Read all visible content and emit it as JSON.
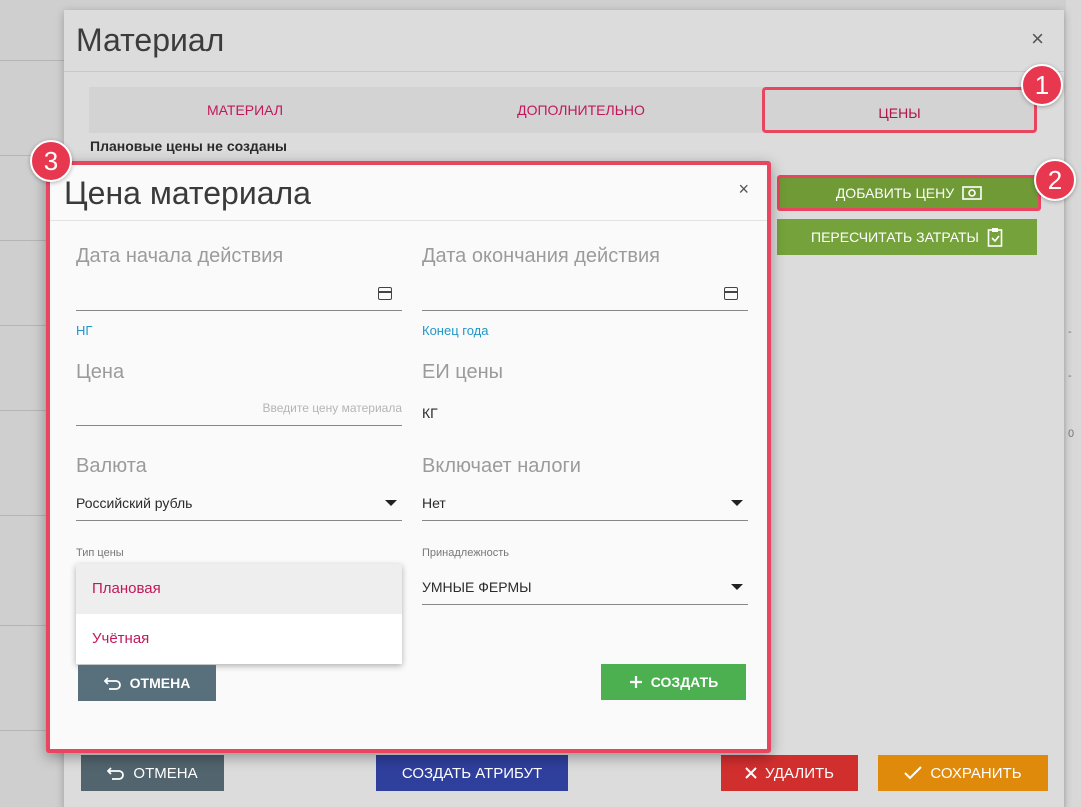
{
  "outer": {
    "title": "Материал",
    "close": "×",
    "tabs": [
      {
        "label": "МАТЕРИАЛ"
      },
      {
        "label": "ДОПОЛНИТЕЛЬНО"
      },
      {
        "label": "ЦЕНЫ"
      }
    ],
    "note": "Плановые цены не созданы",
    "add_price_label": "ДОБАВИТЬ ЦЕНУ",
    "recalc_label": "ПЕРЕСЧИТАТЬ ЗАТРАТЫ",
    "footer": {
      "cancel_label": "ОТМЕНА",
      "create_attr_label": "СОЗДАТЬ АТРИБУТ",
      "delete_label": "УДАЛИТЬ",
      "save_label": "СОХРАНИТЬ"
    }
  },
  "badges": [
    "1",
    "2",
    "3"
  ],
  "modal": {
    "title": "Цена материала",
    "close": "×",
    "start_date": {
      "label": "Дата начала действия",
      "value": "",
      "hint": "НГ"
    },
    "end_date": {
      "label": "Дата окончания действия",
      "value": "",
      "hint": "Конец года"
    },
    "price": {
      "label": "Цена",
      "placeholder": "Введите цену материала"
    },
    "unit": {
      "label": "ЕИ цены",
      "value": "КГ"
    },
    "currency": {
      "label": "Валюта",
      "value": "Российский рубль"
    },
    "taxes": {
      "label": "Включает налоги",
      "value": "Нет"
    },
    "price_type": {
      "label": "Тип цены",
      "options": [
        "Плановая",
        "Учётная"
      ]
    },
    "ownership": {
      "label": "Принадлежность",
      "value": "УМНЫЕ ФЕРМЫ"
    },
    "cancel_label": "ОТМЕНА",
    "create_label": "СОЗДАТЬ"
  },
  "background": {
    "right_marks": [
      "-",
      "-",
      "0"
    ]
  },
  "colors": {
    "accent": "#c2185b",
    "highlight": "#e84560",
    "green": "#4caf50",
    "link": "#2196c9"
  }
}
